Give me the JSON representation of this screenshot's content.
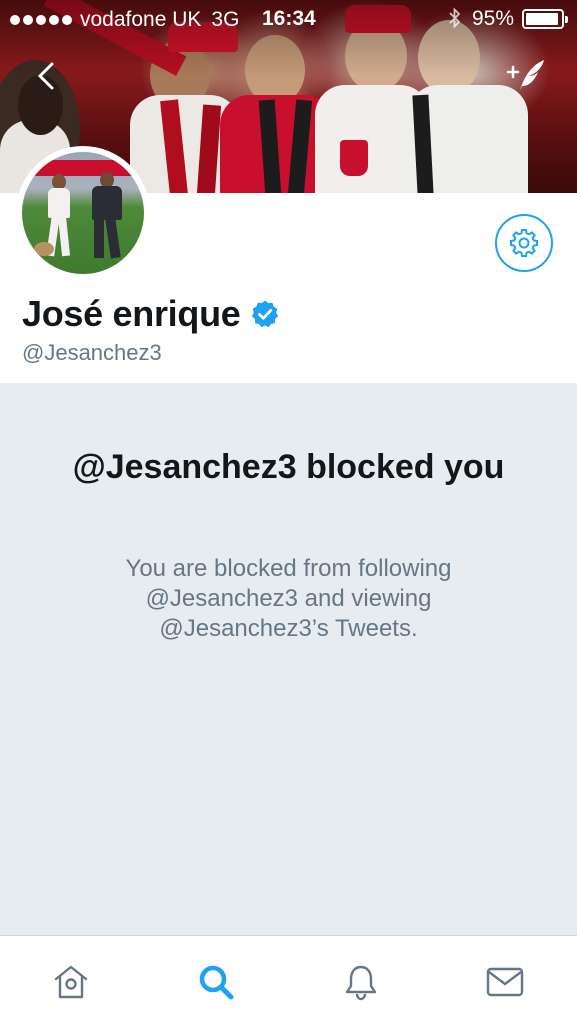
{
  "status_bar": {
    "signal_dots": 5,
    "carrier": "vodafone UK",
    "network": "3G",
    "time": "16:34",
    "bluetooth_icon": "bluetooth-icon",
    "battery_percent": "95%",
    "battery_level": 0.95
  },
  "header": {
    "back_icon": "chevron-left-icon",
    "compose_icon": "compose-tweet-icon"
  },
  "profile": {
    "display_name": "José enrique",
    "verified_icon": "verified-badge-icon",
    "handle": "@Jesanchez3",
    "settings_icon": "gear-icon"
  },
  "blocked": {
    "title": "@Jesanchez3 blocked you",
    "description": "You are blocked from following @Jesanchez3 and viewing @Jesanchez3’s Tweets."
  },
  "tab_bar": {
    "tabs": [
      {
        "name": "home",
        "icon": "home-icon",
        "active": false
      },
      {
        "name": "search",
        "icon": "search-icon",
        "active": true
      },
      {
        "name": "notifications",
        "icon": "bell-icon",
        "active": false
      },
      {
        "name": "messages",
        "icon": "mail-icon",
        "active": false
      }
    ]
  },
  "colors": {
    "accent": "#1da1f2",
    "text_primary": "#14171a",
    "text_secondary": "#657786",
    "panel_bg": "#e6ecf0",
    "icon_inactive": "#657786"
  }
}
